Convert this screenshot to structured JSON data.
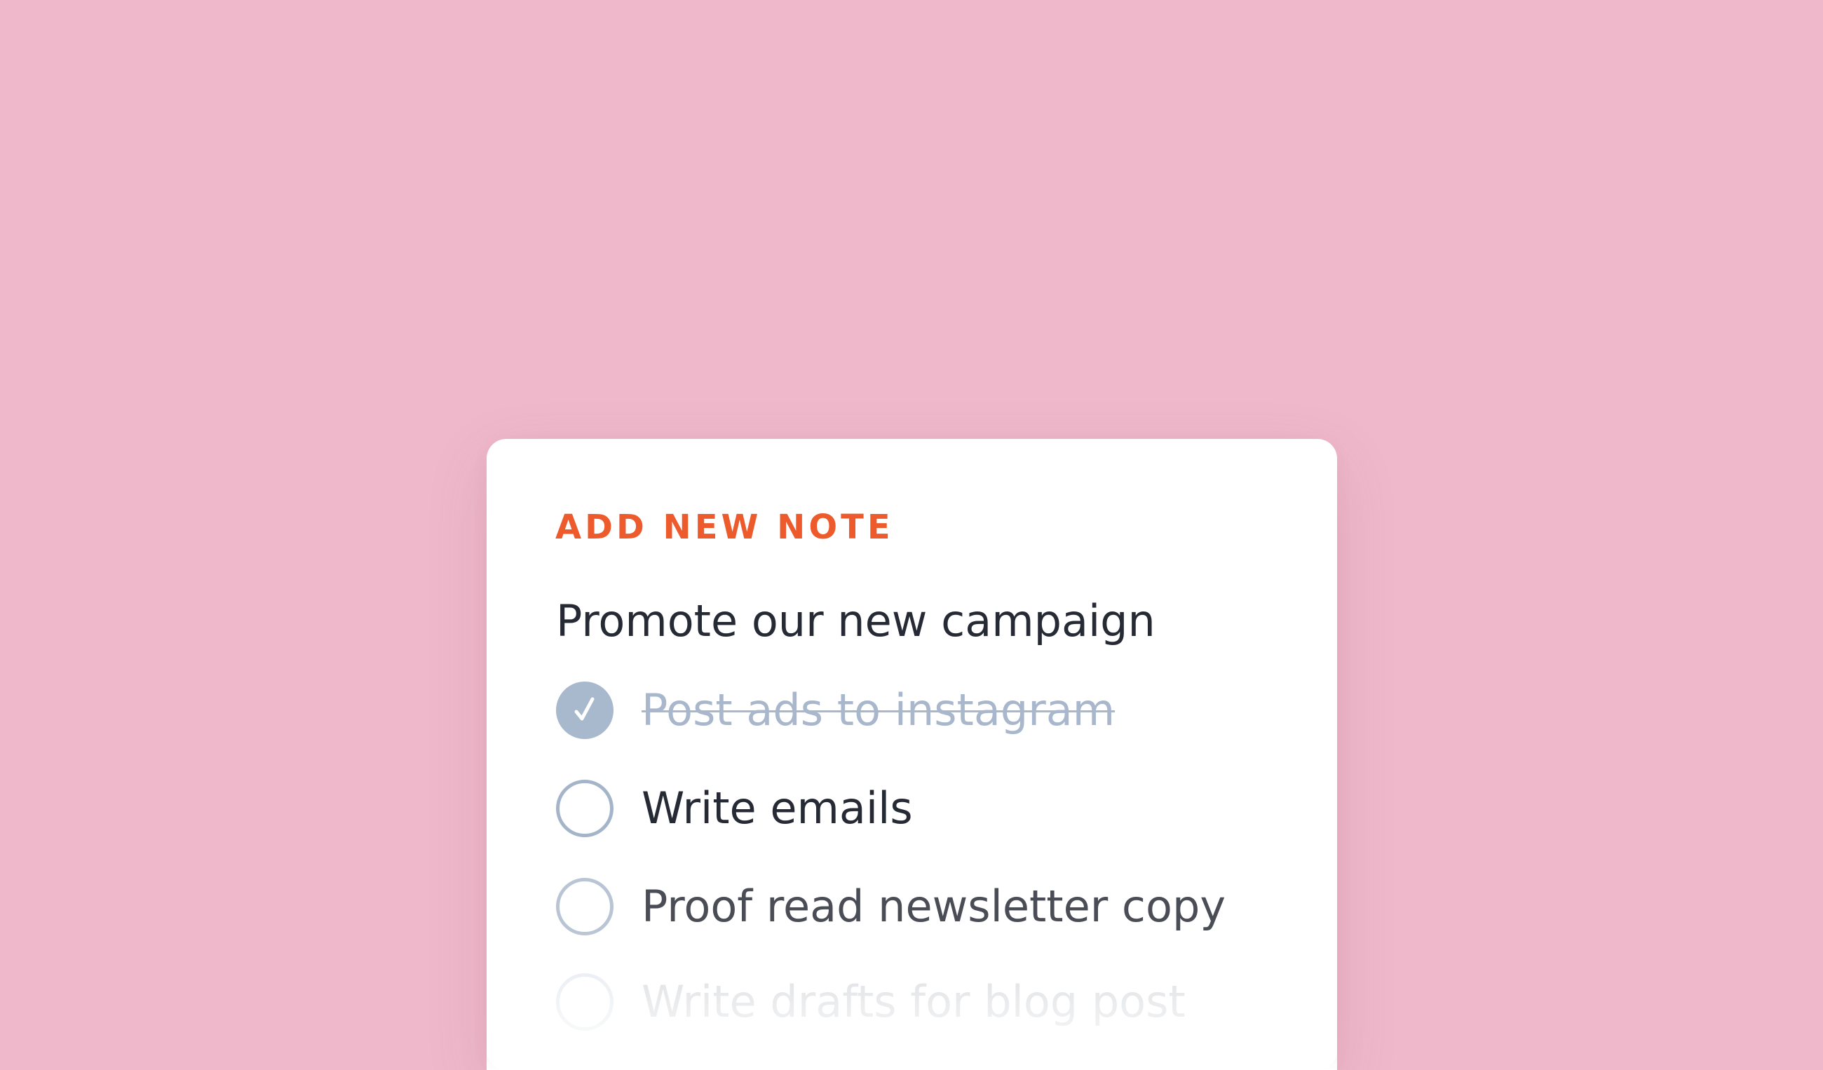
{
  "note_card": {
    "heading": "ADD NEW NOTE",
    "title": "Promote our new campaign",
    "tasks": [
      {
        "label": "Post ads to instagram",
        "checked": true
      },
      {
        "label": "Write emails",
        "checked": false
      },
      {
        "label": "Proof read newsletter copy",
        "checked": false
      },
      {
        "label": "Write drafts for blog post",
        "checked": false
      }
    ]
  },
  "colors": {
    "background": "#efb9cb",
    "card": "#ffffff",
    "accent": "#ed5b2d",
    "text": "#262a34",
    "muted": "#a8b7cc",
    "checkbox": "#a5b5c9"
  },
  "icons": {
    "checkmark": "checkmark-icon"
  }
}
